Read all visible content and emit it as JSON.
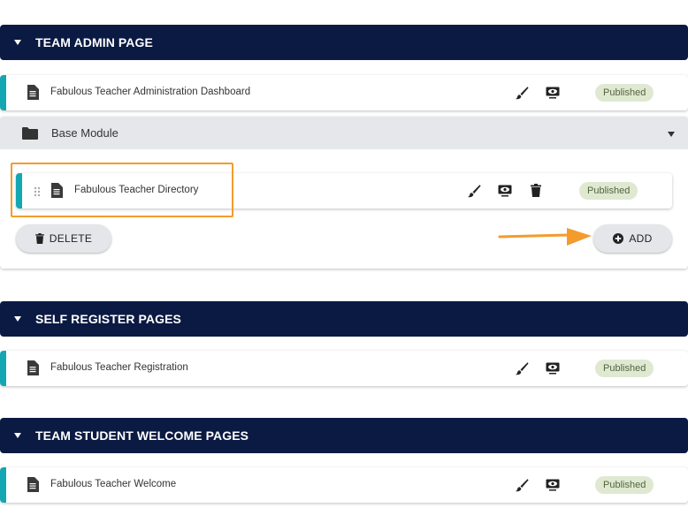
{
  "sections": [
    {
      "title": "TEAM ADMIN PAGE",
      "pages": [
        {
          "title": "Fabulous Teacher Administration Dashboard",
          "status": "Published"
        }
      ]
    },
    {
      "title": "SELF REGISTER PAGES",
      "pages": [
        {
          "title": "Fabulous Teacher Registration",
          "status": "Published"
        }
      ]
    },
    {
      "title": "TEAM STUDENT WELCOME PAGES",
      "pages": [
        {
          "title": "Fabulous Teacher Welcome",
          "status": "Published"
        }
      ]
    }
  ],
  "module": {
    "title": "Base Module",
    "pages": [
      {
        "title": "Fabulous Teacher Directory",
        "status": "Published"
      }
    ],
    "delete_label": "DELETE",
    "add_label": "ADD"
  },
  "colors": {
    "header_bg": "#0b1a43",
    "accent": "#12a7b2",
    "badge_bg": "#dfe9d1",
    "highlight": "#f39c2b"
  },
  "icons": [
    "caret-down-icon",
    "document-icon",
    "brush-icon",
    "preview-icon",
    "folder-icon",
    "drag-handle-icon",
    "trash-icon",
    "plus-circle-icon",
    "arrow-right-icon"
  ]
}
